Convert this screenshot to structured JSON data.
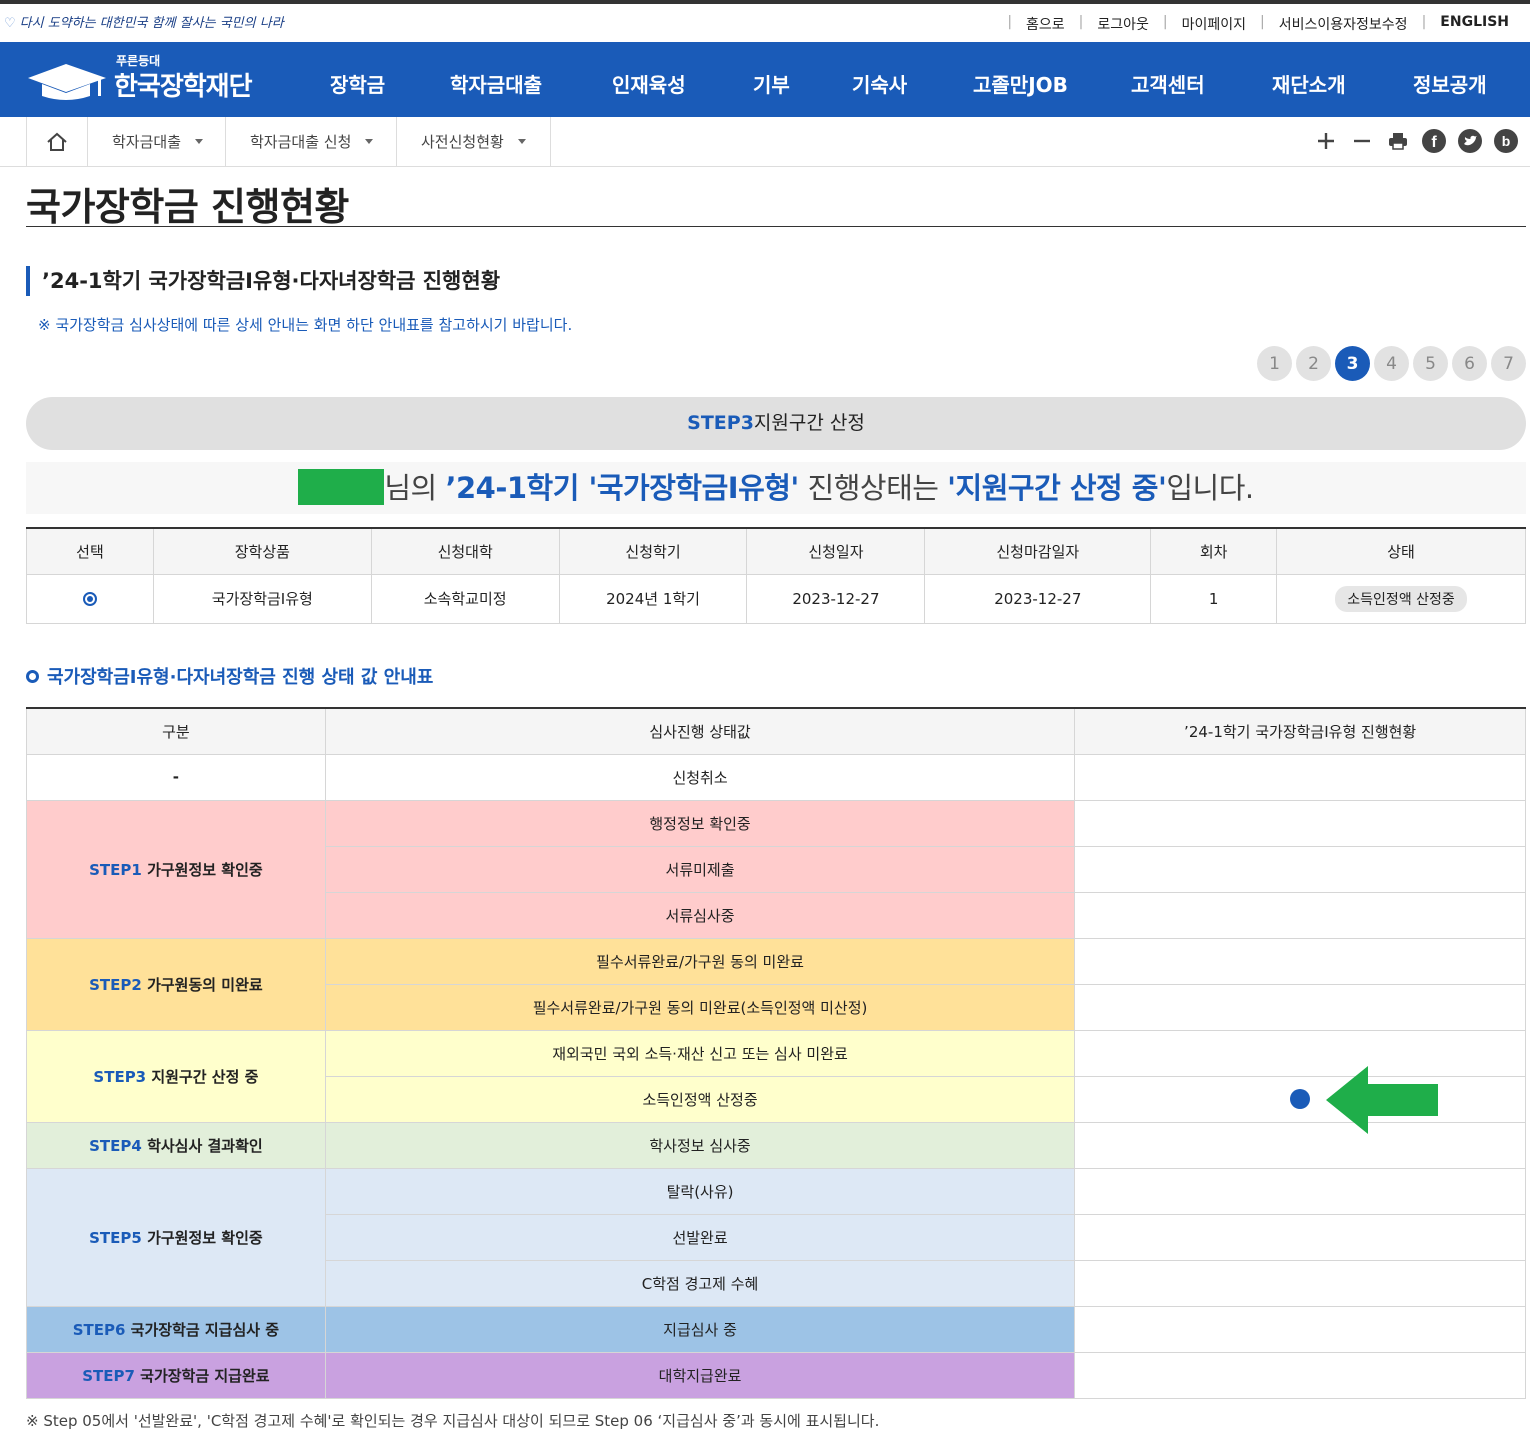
{
  "util": {
    "slogan": "다시 도약하는 대한민국 함께 잘사는 국민의 나라",
    "links": [
      "홈으로",
      "로그아웃",
      "마이페이지",
      "서비스이용자정보수정",
      "ENGLISH"
    ]
  },
  "logo": {
    "sub": "푸른등대",
    "name": "한국장학재단"
  },
  "gnb": [
    "장학금",
    "학자금대출",
    "인재육성",
    "기부",
    "기숙사",
    "고졸만JOB",
    "고객센터",
    "재단소개",
    "정보공개"
  ],
  "breadcrumb": [
    "학자금대출",
    "학자금대출 신청",
    "사전신청현황"
  ],
  "page_title": "국가장학금 진행현황",
  "section_title": "’24-1학기 국가장학금Ⅰ유형·다자녀장학금 진행현황",
  "notice": "※ 국가장학금 심사상태에 따른 상세 안내는 화면 하단 안내표를 참고하시기 바랍니다.",
  "pager": {
    "pages": [
      "1",
      "2",
      "3",
      "4",
      "5",
      "6",
      "7"
    ],
    "current": "3"
  },
  "step_pill": {
    "step": "STEP3",
    "label": "지원구간 산정"
  },
  "status": {
    "p1": "님의 ",
    "term": "’24-1학기 '국가장학금Ⅰ유형'",
    "p2": " 진행상태는 ",
    "state": "'지원구간 산정 중'",
    "p3": "입니다."
  },
  "apply_table": {
    "headers": [
      "선택",
      "장학상품",
      "신청대학",
      "신청학기",
      "신청일자",
      "신청마감일자",
      "회차",
      "상태"
    ],
    "row": {
      "product": "국가장학금Ⅰ유형",
      "university": "소속학교미정",
      "term": "2024년 1학기",
      "apply_date": "2023-12-27",
      "deadline": "2023-12-27",
      "round": "1",
      "state": "소득인정액 산정중"
    }
  },
  "guide_title": "국가장학금Ⅰ유형·다자녀장학금 진행 상태 값 안내표",
  "guide_table": {
    "headers": [
      "구분",
      "심사진행 상태값",
      "’24-1학기 국가장학금Ⅰ유형 진행현황"
    ],
    "dash": "-",
    "cancel": "신청취소",
    "steps": [
      {
        "step": "STEP1",
        "label": "가구원정보 확인중",
        "values": [
          "행정정보 확인중",
          "서류미제출",
          "서류심사중"
        ]
      },
      {
        "step": "STEP2",
        "label": "가구원동의 미완료",
        "values": [
          "필수서류완료/가구원 동의 미완료",
          "필수서류완료/가구원 동의 미완료(소득인정액 미산정)"
        ]
      },
      {
        "step": "STEP3",
        "label": "지원구간 산정 중",
        "values": [
          "재외국민 국외 소득·재산 신고 또는 심사 미완료",
          "소득인정액 산정중"
        ]
      },
      {
        "step": "STEP4",
        "label": "학사심사 결과확인",
        "values": [
          "학사정보 심사중"
        ]
      },
      {
        "step": "STEP5",
        "label": "가구원정보 확인중",
        "values": [
          "탈락(사유)",
          "선발완료",
          "C학점 경고제 수혜"
        ]
      },
      {
        "step": "STEP6",
        "label": "국가장학금 지급심사 중",
        "values": [
          "지급심사 중"
        ]
      },
      {
        "step": "STEP7",
        "label": "국가장학금 지급완료",
        "values": [
          "대학지급완료"
        ]
      }
    ],
    "current": "소득인정액 산정중"
  },
  "footnote": "※ Step 05에서 '선발완료', 'C학점 경고제 수혜'로 확인되는 경우 지급심사 대상이 되므로 Step 06 ‘지급심사 중’과 동시에 표시됩니다.",
  "colors": {
    "brand": "#1a5bb8",
    "mask": "#1fae4a",
    "arrow": "#1fae4a"
  }
}
